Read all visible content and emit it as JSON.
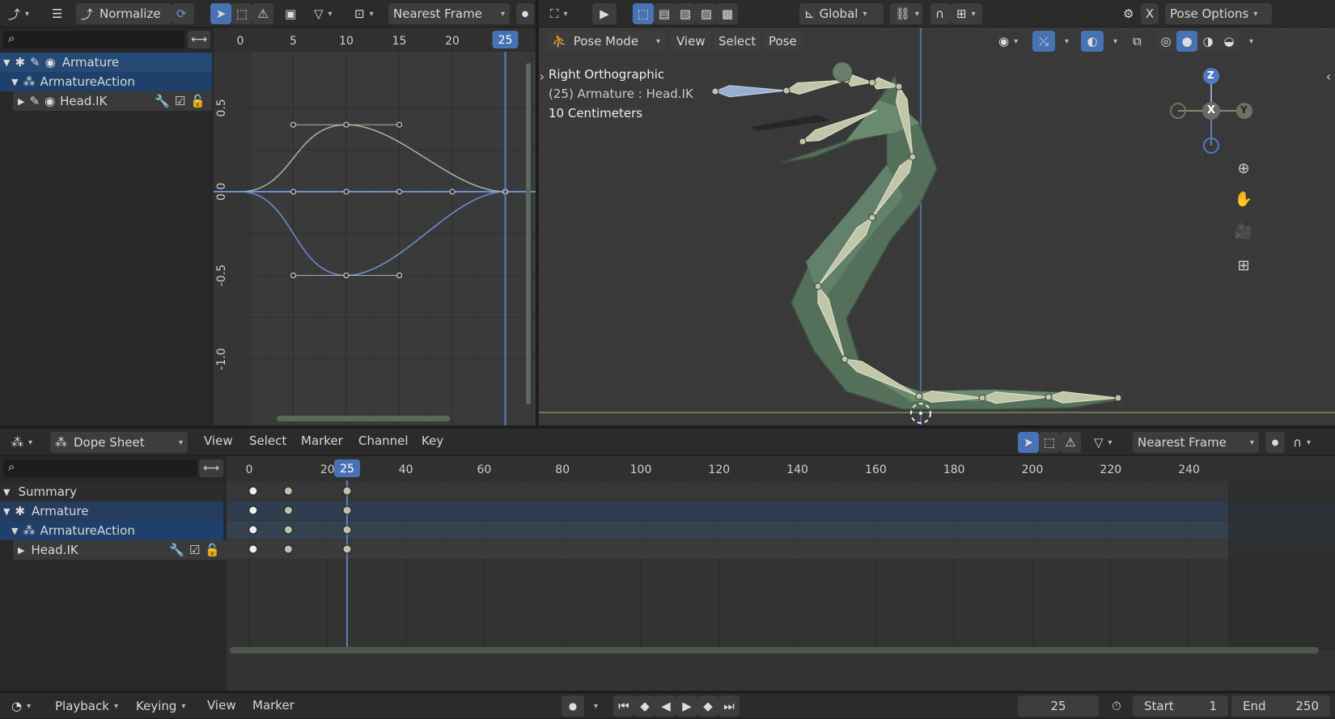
{
  "graph_editor": {
    "mode_label": "Normalize",
    "snap": "Nearest Frame",
    "ruler": [
      "0",
      "5",
      "10",
      "15",
      "20"
    ],
    "current_frame": "25",
    "y_ticks": [
      "0.5",
      "0.0",
      "-0.5",
      "-1.0"
    ],
    "channels": [
      {
        "label": "Armature"
      },
      {
        "label": "ArmatureAction"
      },
      {
        "label": "Head.IK"
      }
    ]
  },
  "viewport": {
    "mode": "Pose Mode",
    "menus": [
      "View",
      "Select",
      "Pose"
    ],
    "orientation": "Global",
    "pose_options": "Pose Options",
    "overlay_title": "Right Orthographic",
    "overlay_sub": "(25) Armature : Head.IK",
    "overlay_scale": "10 Centimeters",
    "gizmo": {
      "z": "Z",
      "x": "X",
      "y": "Y"
    }
  },
  "dopesheet": {
    "editor_label": "Dope Sheet",
    "menus": [
      "View",
      "Select",
      "Marker",
      "Channel",
      "Key"
    ],
    "snap": "Nearest Frame",
    "ruler": [
      "0",
      "20",
      "40",
      "60",
      "80",
      "100",
      "120",
      "140",
      "160",
      "180",
      "200",
      "220",
      "240"
    ],
    "current_frame": "25",
    "channels": [
      {
        "label": "Summary"
      },
      {
        "label": "Armature"
      },
      {
        "label": "ArmatureAction"
      },
      {
        "label": "Head.IK"
      }
    ]
  },
  "timeline": {
    "menus": [
      "Playback",
      "Keying",
      "View",
      "Marker"
    ],
    "current_frame": "25",
    "start_label": "Start",
    "start_value": "1",
    "end_label": "End",
    "end_value": "250"
  },
  "colors": {
    "accent": "#4772b3",
    "panel": "#2b2b2b",
    "viewport_bg": "#393939",
    "curve_blue": "#6d8fd4",
    "curve_green": "#a5b89c",
    "mesh": "#55705a"
  }
}
